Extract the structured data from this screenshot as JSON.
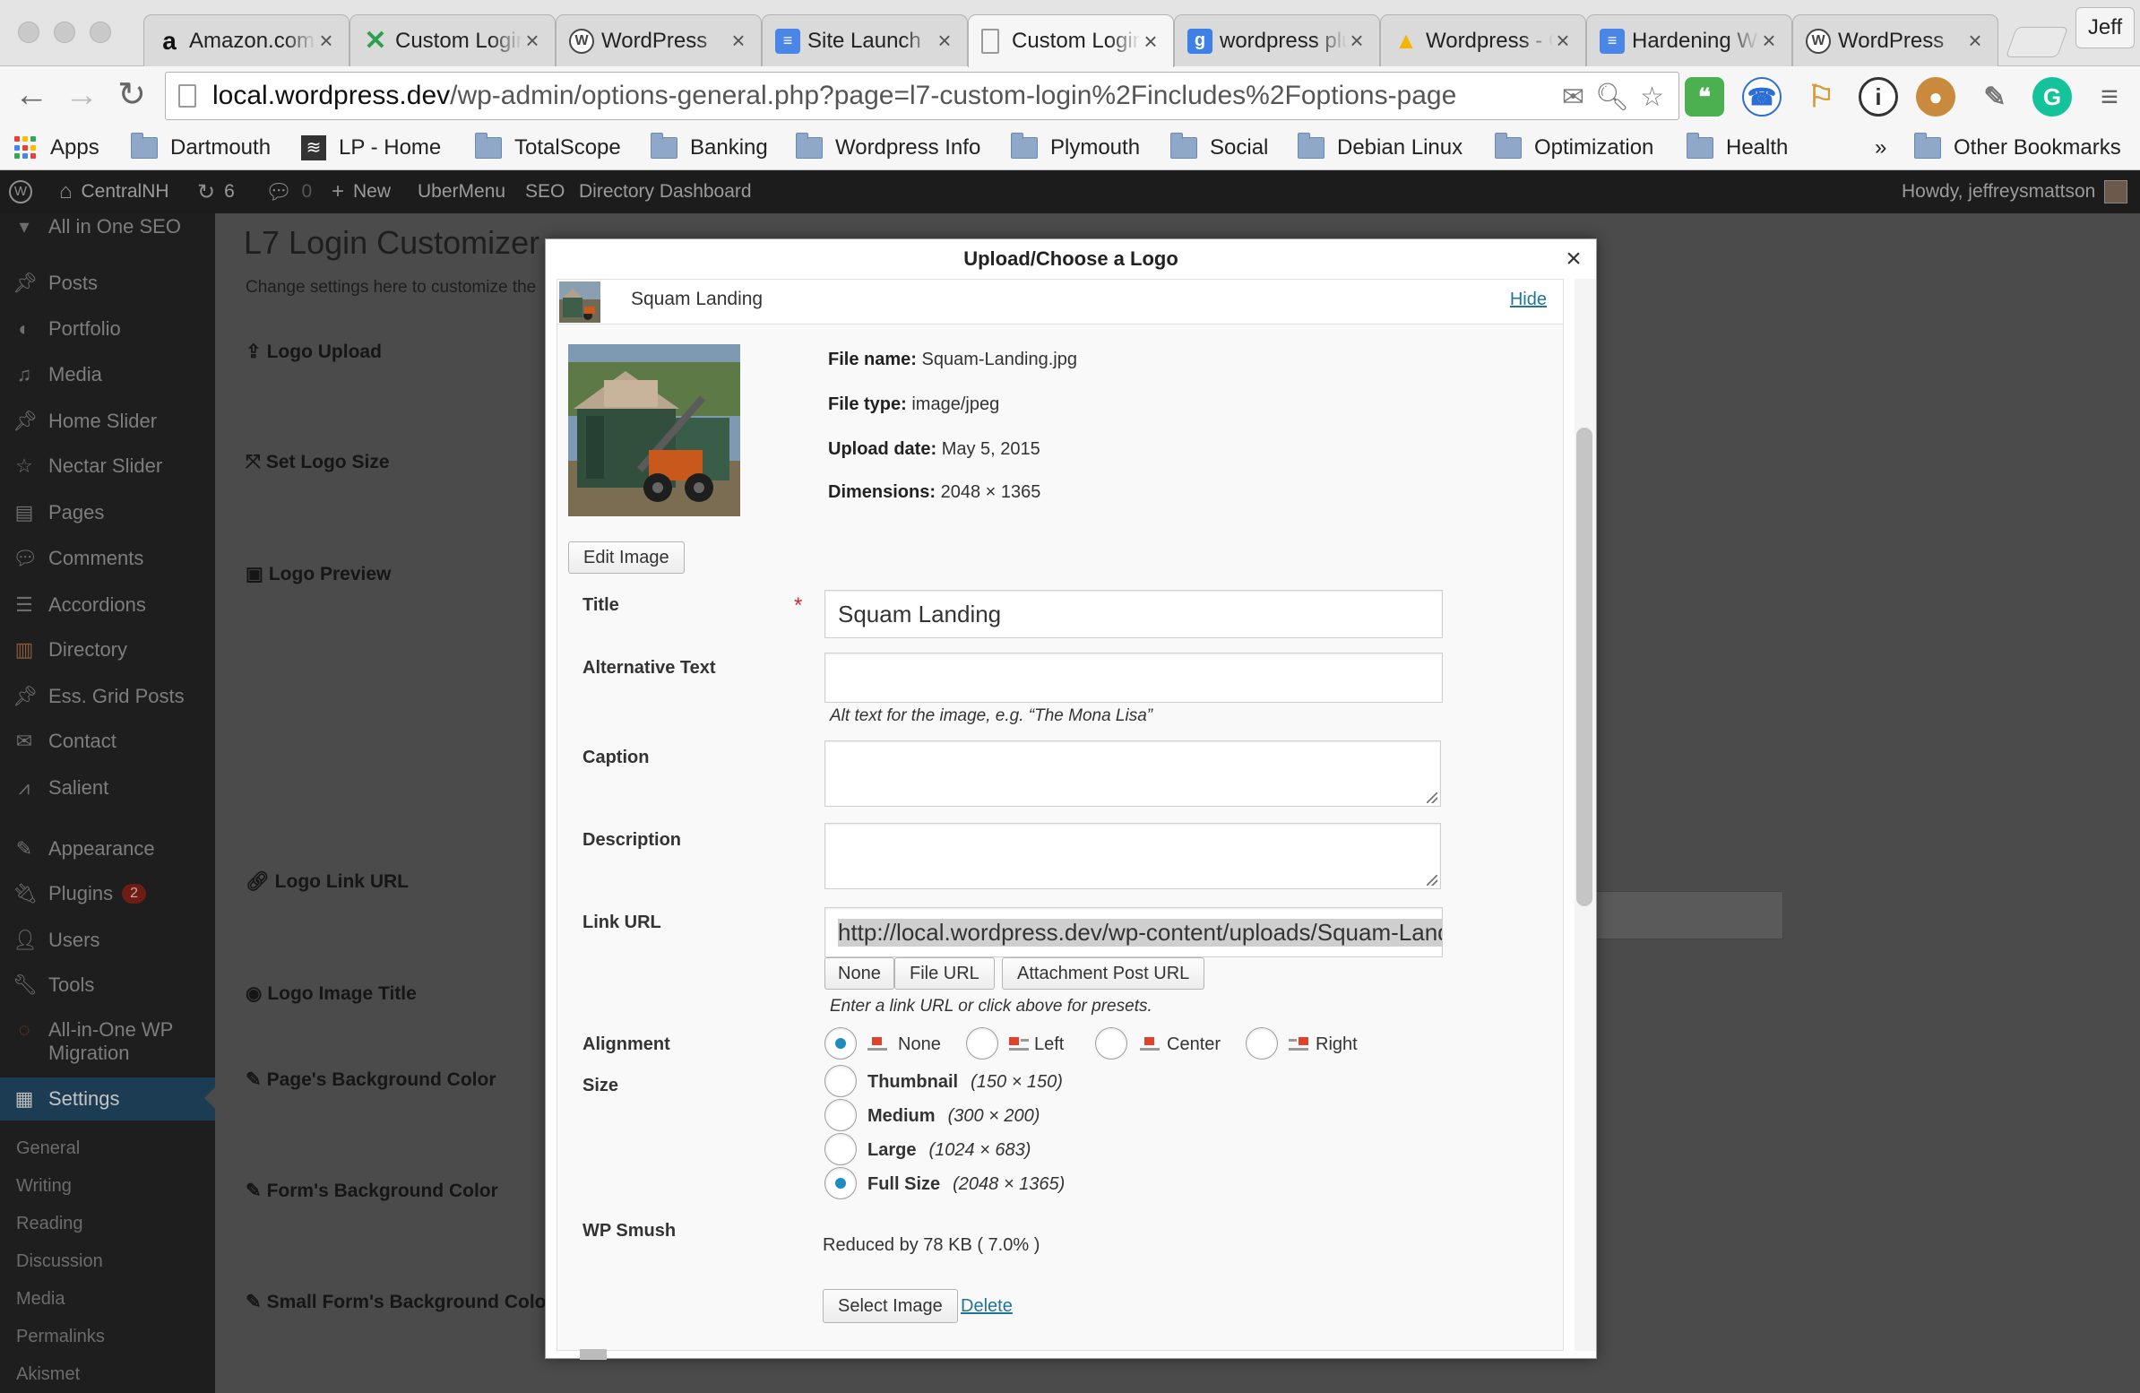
{
  "browser": {
    "tabs": [
      {
        "label": "Amazon.com",
        "icon": "amazon-icon",
        "color": "#111111",
        "glyph": "a"
      },
      {
        "label": "Custom Login",
        "icon": "xvector-icon",
        "color": "#2e9e4f",
        "glyph": "✕"
      },
      {
        "label": "WordPress",
        "icon": "wordpress-icon",
        "color": "#464646",
        "glyph": "W"
      },
      {
        "label": "Site Launch",
        "icon": "google-docs-icon",
        "color": "#4a86e8",
        "glyph": "≡"
      },
      {
        "label": "Custom Login",
        "icon": "blank-page-icon",
        "color": "#ffffff",
        "glyph": ""
      },
      {
        "label": "wordpress plugin",
        "icon": "google-search-icon",
        "color": "#3f7fe8",
        "glyph": "g"
      },
      {
        "label": "Wordpress - Google Drive",
        "icon": "google-drive-icon",
        "color": "#f4b400",
        "glyph": "▲"
      },
      {
        "label": "Hardening WordPress",
        "icon": "google-docs-icon",
        "color": "#4a86e8",
        "glyph": "≡"
      },
      {
        "label": "WordPress",
        "icon": "wordpress-icon",
        "color": "#464646",
        "glyph": "W"
      }
    ],
    "active_tab_index": 4,
    "profile_name": "Jeff",
    "url_host": "local.wordpress.dev",
    "url_path": "/wp-admin/options-general.php?page=l7-custom-login%2Fincludes%2Foptions-page",
    "bookmarks": [
      "Apps",
      "Dartmouth",
      "LP - Home",
      "TotalScope",
      "Banking",
      "Wordpress Info",
      "Plymouth",
      "Social",
      "Debian Linux",
      "Optimization",
      "Health"
    ],
    "bookmarks_overflow": "»",
    "other_bookmarks": "Other Bookmarks"
  },
  "adminbar": {
    "site": "CentralNH",
    "updates": "6",
    "comments": "0",
    "new": "New",
    "items": [
      "UberMenu",
      "SEO",
      "Directory Dashboard"
    ],
    "howdy": "Howdy, jeffreysmattson"
  },
  "sidebar": {
    "items": [
      "All in One SEO",
      "Posts",
      "Portfolio",
      "Media",
      "Home Slider",
      "Nectar Slider",
      "Pages",
      "Comments",
      "Accordions",
      "Directory",
      "Ess. Grid Posts",
      "Contact",
      "Salient",
      "Appearance",
      "Plugins",
      "Users",
      "Tools",
      "All-in-One WP Migration",
      "Settings"
    ],
    "plugins_badge": "2",
    "submenu": [
      "General",
      "Writing",
      "Reading",
      "Discussion",
      "Media",
      "Permalinks",
      "Akismet"
    ]
  },
  "page": {
    "title": "L7 Login Customizer",
    "description": "Change settings here to customize the",
    "sections": [
      "Logo Upload",
      "Set Logo Size",
      "Logo Preview",
      "Logo Link URL",
      "Logo Image Title",
      "Page's Background Color",
      "Form's Background Color",
      "Small Form's Background Color"
    ]
  },
  "modal": {
    "title": "Upload/Choose a Logo",
    "close": "×",
    "item_title": "Squam Landing",
    "hide_link": "Hide",
    "file_name_label": "File name:",
    "file_name": "Squam-Landing.jpg",
    "file_type_label": "File type:",
    "file_type": "image/jpeg",
    "upload_date_label": "Upload date:",
    "upload_date": "May 5, 2015",
    "dimensions_label": "Dimensions:",
    "dimensions": "2048 × 1365",
    "edit_image": "Edit Image",
    "title_label": "Title",
    "required_mark": "*",
    "title_value": "Squam Landing",
    "alt_label": "Alternative Text",
    "alt_value": "",
    "alt_help": "Alt text for the image, e.g. “The Mona Lisa”",
    "caption_label": "Caption",
    "caption_value": "",
    "description_label": "Description",
    "description_value": "",
    "link_label": "Link URL",
    "link_value": "http://local.wordpress.dev/wp-content/uploads/Squam-Landing.jpg",
    "link_buttons": [
      "None",
      "File URL",
      "Attachment Post URL"
    ],
    "link_help": "Enter a link URL or click above for presets.",
    "alignment_label": "Alignment",
    "alignment_options": [
      "None",
      "Left",
      "Center",
      "Right"
    ],
    "alignment_selected": "None",
    "size_label": "Size",
    "sizes": [
      {
        "name": "Thumbnail",
        "dims": "(150 × 150)"
      },
      {
        "name": "Medium",
        "dims": "(300 × 200)"
      },
      {
        "name": "Large",
        "dims": "(1024 × 683)"
      },
      {
        "name": "Full Size",
        "dims": "(2048 × 1365)"
      }
    ],
    "size_selected": "Full Size",
    "smush_label": "WP Smush",
    "smush_result": "Reduced by 78 KB ( 7.0% )",
    "select_image": "Select Image",
    "delete": "Delete"
  },
  "colors": {
    "wp_accent": "#1e8cbe",
    "link": "#21759b",
    "required": "#d62828",
    "admin_bar": "#1c1c1c",
    "settings_active": "#1b3c52"
  }
}
